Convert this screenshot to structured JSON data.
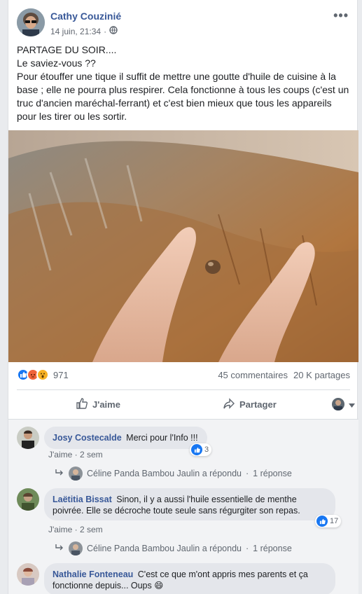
{
  "post": {
    "author": "Cathy Couzinié",
    "date": "14 juin, 21:34",
    "privacy_icon": "globe-icon",
    "more_label": "•••",
    "text_lines": [
      "PARTAGE DU SOIR....",
      "Le saviez-vous ??",
      "Pour étouffer une tique il suffit de mettre une goutte d'huile de cuisine à la base ; elle ne pourra plus respirer. Cela fonctionne à tous les coups (c'est un truc d'ancien maréchal-ferrant) et c'est bien mieux que tous les appareils pour les tirer ou les sortir."
    ]
  },
  "stats": {
    "reaction_count": "971",
    "comments": "45 commentaires",
    "shares": "20 K partages"
  },
  "actions": {
    "like": "J'aime",
    "share": "Partager"
  },
  "comments": [
    {
      "name": "Josy Costecalde",
      "text": "Merci pour l'Info !!!",
      "likes": "3",
      "like_label": "J'aime",
      "time": "2 sem",
      "reply_text": "Céline Panda Bambou Jaulin a répondu",
      "reply_count": "1 réponse"
    },
    {
      "name": "Laëtitia Bissat",
      "text_line1": "Sinon, il y a aussi l'huile essentielle de menthe",
      "text_line2": "poivrée. Elle se décroche toute seule sans régurgiter son repas.",
      "likes": "17",
      "like_label": "J'aime",
      "time": "2 sem",
      "reply_text": "Céline Panda Bambou Jaulin a répondu",
      "reply_count": "1 réponse"
    },
    {
      "name": "Nathalie Fonteneau",
      "text_line1": "C'est ce que m'ont appris mes parents et ça",
      "text_line2": "fonctionne depuis... Oups 😄"
    }
  ],
  "colors": {
    "link": "#385898",
    "like_blue": "#1877f2",
    "angry": "#f0643a",
    "wow": "#f7b125"
  }
}
